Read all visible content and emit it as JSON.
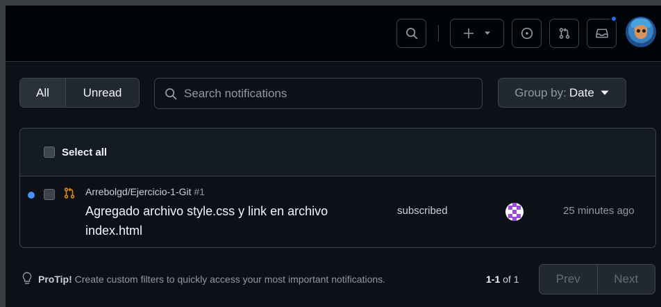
{
  "header": {
    "search_icon": "search-icon",
    "create_icon": "plus-icon",
    "create_dropdown_icon": "triangle-down-icon",
    "issues_icon": "issue-opened-icon",
    "pulls_icon": "git-pull-request-icon",
    "inbox_icon": "inbox-icon",
    "inbox_has_unread": true,
    "avatar": "user-avatar"
  },
  "filters": {
    "all_label": "All",
    "unread_label": "Unread",
    "search_placeholder": "Search notifications",
    "group_by_prefix": "Group by:",
    "group_by_value": "Date"
  },
  "list": {
    "select_all_label": "Select all",
    "items": [
      {
        "repo": "Arrebolgd/Ejercicio-1-Git",
        "number": "#1",
        "title": "Agregado archivo style.css y link en archivo index.html",
        "reason": "subscribed",
        "time": "25 minutes ago",
        "unread": true,
        "type_icon": "git-pull-request-icon"
      }
    ]
  },
  "footer": {
    "protip_label": "ProTip!",
    "protip_text": "Create custom filters to quickly access your most important notifications.",
    "range": "1-1",
    "of_text": "of 1",
    "prev_label": "Prev",
    "next_label": "Next"
  },
  "colors": {
    "background": "#0d1117",
    "header": "#010409",
    "border": "#3d444d",
    "unread_dot": "#4493f8",
    "pr_icon": "#d18616"
  }
}
